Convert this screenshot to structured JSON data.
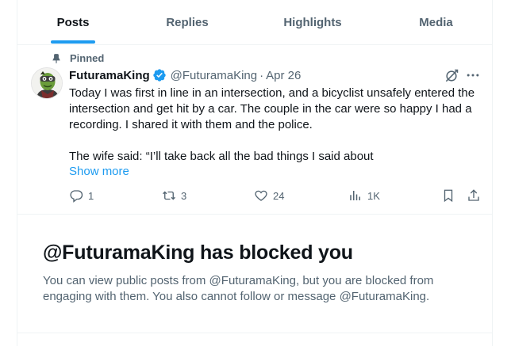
{
  "tabs": [
    {
      "label": "Posts",
      "active": true
    },
    {
      "label": "Replies",
      "active": false
    },
    {
      "label": "Highlights",
      "active": false
    },
    {
      "label": "Media",
      "active": false
    }
  ],
  "post": {
    "pinned_label": "Pinned",
    "name": "FuturamaKing",
    "handle": "@FuturamaKing",
    "separator": "·",
    "date": "Apr 26",
    "text_lines": [
      "Today I was first in line in an intersection, and a bicyclist unsafely entered the intersection and get hit by a car. The couple in the car were so happy I had a recording. I shared it with them and the police.",
      "The wife said: “I’ll take back all the bad things I said about"
    ],
    "show_more": "Show more",
    "actions": {
      "replies": "1",
      "reposts": "3",
      "likes": "24",
      "views": "1K"
    }
  },
  "blocked": {
    "title": "@FuturamaKing has blocked you",
    "description": "You can view public posts from @FuturamaKing, but you are blocked from engaging with them. You also cannot follow or message @FuturamaKing."
  },
  "colors": {
    "accent": "#1d9bf0",
    "text": "#0f1419",
    "muted": "#536471",
    "border": "#eff3f4"
  },
  "icons": [
    "pin-icon",
    "verified-badge-icon",
    "grok-icon",
    "more-icon",
    "reply-icon",
    "repost-icon",
    "like-icon",
    "views-icon",
    "bookmark-icon",
    "share-icon"
  ]
}
